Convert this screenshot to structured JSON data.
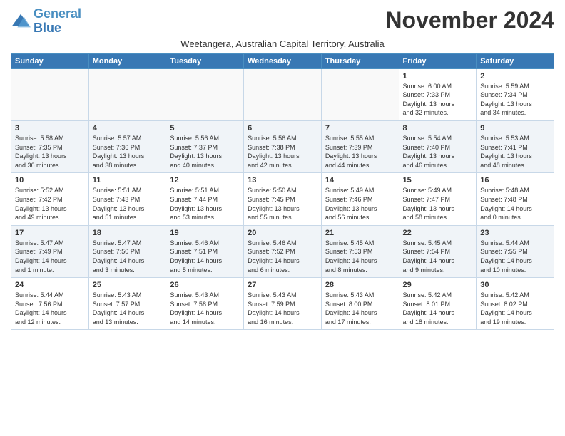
{
  "logo": {
    "line1": "General",
    "line2": "Blue"
  },
  "title": "November 2024",
  "subtitle": "Weetangera, Australian Capital Territory, Australia",
  "days_of_week": [
    "Sunday",
    "Monday",
    "Tuesday",
    "Wednesday",
    "Thursday",
    "Friday",
    "Saturday"
  ],
  "weeks": [
    [
      {
        "day": "",
        "info": ""
      },
      {
        "day": "",
        "info": ""
      },
      {
        "day": "",
        "info": ""
      },
      {
        "day": "",
        "info": ""
      },
      {
        "day": "",
        "info": ""
      },
      {
        "day": "1",
        "info": "Sunrise: 6:00 AM\nSunset: 7:33 PM\nDaylight: 13 hours\nand 32 minutes."
      },
      {
        "day": "2",
        "info": "Sunrise: 5:59 AM\nSunset: 7:34 PM\nDaylight: 13 hours\nand 34 minutes."
      }
    ],
    [
      {
        "day": "3",
        "info": "Sunrise: 5:58 AM\nSunset: 7:35 PM\nDaylight: 13 hours\nand 36 minutes."
      },
      {
        "day": "4",
        "info": "Sunrise: 5:57 AM\nSunset: 7:36 PM\nDaylight: 13 hours\nand 38 minutes."
      },
      {
        "day": "5",
        "info": "Sunrise: 5:56 AM\nSunset: 7:37 PM\nDaylight: 13 hours\nand 40 minutes."
      },
      {
        "day": "6",
        "info": "Sunrise: 5:56 AM\nSunset: 7:38 PM\nDaylight: 13 hours\nand 42 minutes."
      },
      {
        "day": "7",
        "info": "Sunrise: 5:55 AM\nSunset: 7:39 PM\nDaylight: 13 hours\nand 44 minutes."
      },
      {
        "day": "8",
        "info": "Sunrise: 5:54 AM\nSunset: 7:40 PM\nDaylight: 13 hours\nand 46 minutes."
      },
      {
        "day": "9",
        "info": "Sunrise: 5:53 AM\nSunset: 7:41 PM\nDaylight: 13 hours\nand 48 minutes."
      }
    ],
    [
      {
        "day": "10",
        "info": "Sunrise: 5:52 AM\nSunset: 7:42 PM\nDaylight: 13 hours\nand 49 minutes."
      },
      {
        "day": "11",
        "info": "Sunrise: 5:51 AM\nSunset: 7:43 PM\nDaylight: 13 hours\nand 51 minutes."
      },
      {
        "day": "12",
        "info": "Sunrise: 5:51 AM\nSunset: 7:44 PM\nDaylight: 13 hours\nand 53 minutes."
      },
      {
        "day": "13",
        "info": "Sunrise: 5:50 AM\nSunset: 7:45 PM\nDaylight: 13 hours\nand 55 minutes."
      },
      {
        "day": "14",
        "info": "Sunrise: 5:49 AM\nSunset: 7:46 PM\nDaylight: 13 hours\nand 56 minutes."
      },
      {
        "day": "15",
        "info": "Sunrise: 5:49 AM\nSunset: 7:47 PM\nDaylight: 13 hours\nand 58 minutes."
      },
      {
        "day": "16",
        "info": "Sunrise: 5:48 AM\nSunset: 7:48 PM\nDaylight: 14 hours\nand 0 minutes."
      }
    ],
    [
      {
        "day": "17",
        "info": "Sunrise: 5:47 AM\nSunset: 7:49 PM\nDaylight: 14 hours\nand 1 minute."
      },
      {
        "day": "18",
        "info": "Sunrise: 5:47 AM\nSunset: 7:50 PM\nDaylight: 14 hours\nand 3 minutes."
      },
      {
        "day": "19",
        "info": "Sunrise: 5:46 AM\nSunset: 7:51 PM\nDaylight: 14 hours\nand 5 minutes."
      },
      {
        "day": "20",
        "info": "Sunrise: 5:46 AM\nSunset: 7:52 PM\nDaylight: 14 hours\nand 6 minutes."
      },
      {
        "day": "21",
        "info": "Sunrise: 5:45 AM\nSunset: 7:53 PM\nDaylight: 14 hours\nand 8 minutes."
      },
      {
        "day": "22",
        "info": "Sunrise: 5:45 AM\nSunset: 7:54 PM\nDaylight: 14 hours\nand 9 minutes."
      },
      {
        "day": "23",
        "info": "Sunrise: 5:44 AM\nSunset: 7:55 PM\nDaylight: 14 hours\nand 10 minutes."
      }
    ],
    [
      {
        "day": "24",
        "info": "Sunrise: 5:44 AM\nSunset: 7:56 PM\nDaylight: 14 hours\nand 12 minutes."
      },
      {
        "day": "25",
        "info": "Sunrise: 5:43 AM\nSunset: 7:57 PM\nDaylight: 14 hours\nand 13 minutes."
      },
      {
        "day": "26",
        "info": "Sunrise: 5:43 AM\nSunset: 7:58 PM\nDaylight: 14 hours\nand 14 minutes."
      },
      {
        "day": "27",
        "info": "Sunrise: 5:43 AM\nSunset: 7:59 PM\nDaylight: 14 hours\nand 16 minutes."
      },
      {
        "day": "28",
        "info": "Sunrise: 5:43 AM\nSunset: 8:00 PM\nDaylight: 14 hours\nand 17 minutes."
      },
      {
        "day": "29",
        "info": "Sunrise: 5:42 AM\nSunset: 8:01 PM\nDaylight: 14 hours\nand 18 minutes."
      },
      {
        "day": "30",
        "info": "Sunrise: 5:42 AM\nSunset: 8:02 PM\nDaylight: 14 hours\nand 19 minutes."
      }
    ]
  ]
}
